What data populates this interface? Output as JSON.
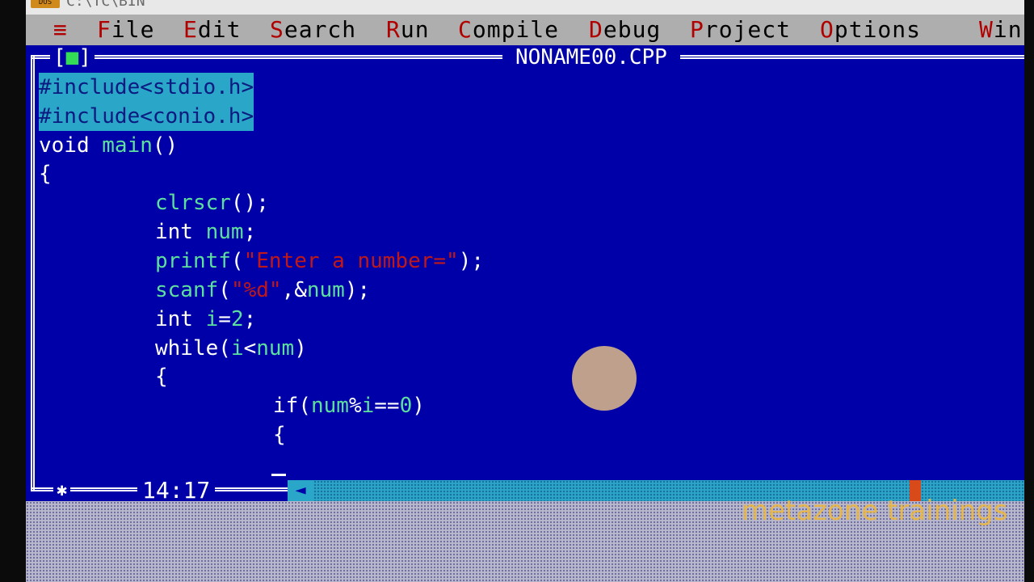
{
  "window": {
    "app_icon_label": "DOS",
    "title_partial": "C:\\TC\\BIN"
  },
  "menu": {
    "system_glyph": "≡",
    "items": [
      {
        "hot": "F",
        "rest": "ile"
      },
      {
        "hot": "E",
        "rest": "dit"
      },
      {
        "hot": "S",
        "rest": "earch"
      },
      {
        "hot": "R",
        "rest": "un"
      },
      {
        "hot": "C",
        "rest": "ompile"
      },
      {
        "hot": "D",
        "rest": "ebug"
      },
      {
        "hot": "P",
        "rest": "roject"
      },
      {
        "hot": "O",
        "rest": "ptions"
      },
      {
        "hot": "W",
        "rest": "in"
      }
    ]
  },
  "editor": {
    "close_box": "[",
    "close_box_inner": "■",
    "close_box_end": "]",
    "file_name": "NONAME00.CPP",
    "code": {
      "l1": "#include<stdio.h>",
      "l2": "#include<conio.h>",
      "l3_kw": "void",
      "l3_id": " main",
      "l3_pun": "()",
      "l4": "{",
      "l5_id": "clrscr",
      "l5_pun": "();",
      "l6_kw": "int",
      "l6_id": " num",
      "l6_pun": ";",
      "l7_id": "printf",
      "l7_p1": "(",
      "l7_str": "\"Enter a number=\"",
      "l7_p2": ");",
      "l8_id": "scanf",
      "l8_p1": "(",
      "l8_str": "\"%d\"",
      "l8_p2": ",&",
      "l8_id2": "num",
      "l8_p3": ");",
      "l9_kw": "int",
      "l9_id": " i",
      "l9_p1": "=",
      "l9_num": "2",
      "l9_p2": ";",
      "l10_kw": "while",
      "l10_p1": "(",
      "l10_id": "i",
      "l10_p2": "<",
      "l10_id2": "num",
      "l10_p3": ")",
      "l11": "{",
      "l12_kw": "if",
      "l12_p1": "(",
      "l12_id": "num",
      "l12_p2": "%",
      "l12_id2": "i",
      "l12_p3": "==",
      "l12_num": "0",
      "l12_p4": ")",
      "l13": "{"
    }
  },
  "status": {
    "star": "✱",
    "cursor_position": "14:17",
    "scroll_left_glyph": "◄"
  },
  "watermark": "metazone trainings"
}
